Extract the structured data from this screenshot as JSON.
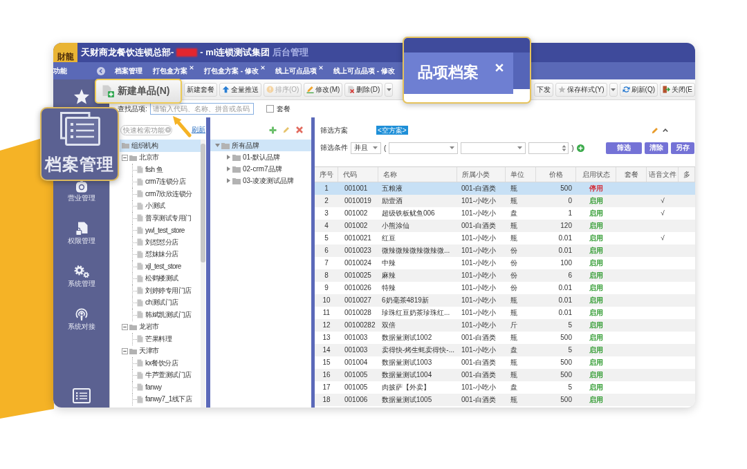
{
  "window": {
    "logo": "財龍",
    "title": "天财商龙餐饮连锁总部-",
    "company": "- ml连锁测试集团",
    "subtitle": "后台管理"
  },
  "tab_bar": {
    "menu_label": "功能",
    "tabs": [
      {
        "label": "档案管理",
        "closable": false,
        "selected": false
      },
      {
        "label": "打包盒方案",
        "closable": true,
        "selected": false
      },
      {
        "label": "打包盒方案 - 修改",
        "closable": true,
        "selected": false
      },
      {
        "label": "线上可点品项",
        "closable": true,
        "selected": false
      },
      {
        "label": "线上可点品项 - 修改",
        "closable": false,
        "selected": false
      }
    ]
  },
  "sidebar": {
    "items": [
      {
        "kind": "star"
      },
      {
        "kind": "bag",
        "label": "营业管理"
      },
      {
        "kind": "document-lock",
        "label": "权限管理"
      },
      {
        "kind": "gears",
        "label": "系统管理"
      },
      {
        "kind": "broadcast",
        "label": "系统对接"
      },
      {
        "kind": "list"
      }
    ]
  },
  "toolbar": {
    "left_buttons": [
      {
        "label": "新建套餐",
        "kind": "plain",
        "disabled": false,
        "dropdown": false
      },
      {
        "label": "全量推送",
        "kind": "push",
        "disabled": false,
        "dropdown": false
      },
      {
        "label": "排序(O)",
        "kind": "sort",
        "disabled": true,
        "dropdown": false
      },
      {
        "label": "修改(M)",
        "kind": "edit",
        "disabled": false,
        "dropdown": false
      },
      {
        "label": "删除(D)",
        "kind": "delete",
        "disabled": false,
        "dropdown": true
      }
    ],
    "right_buttons": [
      {
        "label": "下发",
        "kind": "plain",
        "disabled": false,
        "dropdown": false
      },
      {
        "label": "保存样式(Y)",
        "kind": "save",
        "disabled": false,
        "dropdown": true
      },
      {
        "label": "刷新(Q)",
        "kind": "refresh",
        "disabled": false,
        "dropdown": false
      },
      {
        "label": "关闭(E",
        "kind": "exit",
        "disabled": false,
        "dropdown": false
      }
    ]
  },
  "search": {
    "label": "查找品项:",
    "placeholder": "请输入代码、名称、拼音或条码",
    "checkbox": {
      "label": "套餐",
      "checked": false
    }
  },
  "org_panel": {
    "search_placeholder": "快速检索功能",
    "link": "刷新",
    "tree": [
      {
        "label": "组织机构",
        "selected": true,
        "children": [
          {
            "label": "北京市",
            "selected": false,
            "expanded": true,
            "children": [
              {
                "label": "fish 鱼",
                "selected": false
              },
              {
                "label": "crm7连锁分店",
                "selected": false
              },
              {
                "label": "crm7欣欣连锁分",
                "selected": false
              },
              {
                "label": "小测试",
                "selected": false
              },
              {
                "label": "普享测试专用门",
                "selected": false
              },
              {
                "label": "ywl_test_store",
                "selected": false
              },
              {
                "label": "刘怼怼分店",
                "selected": false
              },
              {
                "label": "怼妹妹分店",
                "selected": false
              },
              {
                "label": "xjl_test_store",
                "selected": false
              },
              {
                "label": "松鹤楼测试",
                "selected": false
              },
              {
                "label": "刘婷婷专用门店",
                "selected": false
              },
              {
                "label": "ch测试门店",
                "selected": false
              },
              {
                "label": "韩斌凯测试门店",
                "selected": false
              }
            ]
          },
          {
            "label": "龙岩市",
            "selected": false,
            "expanded": true,
            "children": [
              {
                "label": "芒果料理",
                "selected": false
              }
            ]
          },
          {
            "label": "天津市",
            "selected": false,
            "expanded": true,
            "children": [
              {
                "label": "kx餐饮分店",
                "selected": false
              },
              {
                "label": "牛芦萱测试门店",
                "selected": false
              },
              {
                "label": "fanwy",
                "selected": false
              },
              {
                "label": "fanwy7_1线下店",
                "selected": false
              }
            ]
          }
        ]
      }
    ]
  },
  "brand_panel": {
    "tree": [
      {
        "label": "所有品牌",
        "selected": true,
        "expanded": true,
        "children": [
          {
            "label": "01-默认品牌",
            "selected": false,
            "expanded": false
          },
          {
            "label": "02-crm7品牌",
            "selected": false,
            "expanded": false
          },
          {
            "label": "03-凌凌测试品牌",
            "selected": false,
            "expanded": false
          }
        ]
      }
    ]
  },
  "filter": {
    "scheme_label": "筛选方案",
    "scheme_value": "<空方案>",
    "condition_label": "筛选条件",
    "operator": "并且",
    "open_paren": "(",
    "close_paren": ")",
    "buttons": [
      "筛选",
      "清除",
      "另存"
    ]
  },
  "table": {
    "columns": [
      "序号",
      "代码",
      "名称",
      "所属小类",
      "单位",
      "价格",
      "启用状态",
      "套餐",
      "语音文件",
      "多"
    ],
    "rows": [
      {
        "no": "1",
        "code": "001001",
        "name": "五粮液",
        "category": "001-白酒类",
        "unit": "瓶",
        "price": "500",
        "status": "停用",
        "enabled": false,
        "selected": true
      },
      {
        "no": "2",
        "code": "0010019",
        "name": "励壹酒",
        "category": "101-小吃小",
        "unit": "瓶",
        "price": "0",
        "status": "启用",
        "enabled": true,
        "voice_file": "√",
        "selected": false
      },
      {
        "no": "3",
        "code": "001002",
        "name": "超级铁板鱿鱼006",
        "category": "101-小吃小",
        "unit": "盘",
        "price": "1",
        "status": "启用",
        "enabled": true,
        "voice_file": "√",
        "selected": false
      },
      {
        "no": "4",
        "code": "001002",
        "name": "小熊涂仙",
        "category": "001-白酒类",
        "unit": "瓶",
        "price": "120",
        "status": "启用",
        "enabled": true,
        "selected": false
      },
      {
        "no": "5",
        "code": "0010021",
        "name": "红豆",
        "category": "101-小吃小",
        "unit": "瓶",
        "price": "0.01",
        "status": "启用",
        "enabled": true,
        "voice_file": "√",
        "selected": false
      },
      {
        "no": "6",
        "code": "0010023",
        "name": "微辣微辣微辣微辣微...",
        "category": "101-小吃小",
        "unit": "份",
        "price": "0.01",
        "status": "启用",
        "enabled": true,
        "selected": false
      },
      {
        "no": "7",
        "code": "0010024",
        "name": "中辣",
        "category": "101-小吃小",
        "unit": "份",
        "price": "100",
        "status": "启用",
        "enabled": true,
        "selected": false
      },
      {
        "no": "8",
        "code": "0010025",
        "name": "麻辣",
        "category": "101-小吃小",
        "unit": "份",
        "price": "6",
        "status": "启用",
        "enabled": true,
        "selected": false
      },
      {
        "no": "9",
        "code": "0010026",
        "name": "特辣",
        "category": "101-小吃小",
        "unit": "份",
        "price": "0.01",
        "status": "启用",
        "enabled": true,
        "selected": false
      },
      {
        "no": "10",
        "code": "0010027",
        "name": "6奶毫茶4819新",
        "category": "101-小吃小",
        "unit": "瓶",
        "price": "0.01",
        "status": "启用",
        "enabled": true,
        "selected": false
      },
      {
        "no": "11",
        "code": "0010028",
        "name": "珍珠红豆奶茶珍珠红...",
        "category": "101-小吃小",
        "unit": "瓶",
        "price": "0.01",
        "status": "启用",
        "enabled": true,
        "selected": false
      },
      {
        "no": "12",
        "code": "00100282",
        "name": "双倍",
        "category": "101-小吃小",
        "unit": "斤",
        "price": "5",
        "status": "启用",
        "enabled": true,
        "selected": false
      },
      {
        "no": "13",
        "code": "001003",
        "name": "数据量测试1002",
        "category": "001-白酒类",
        "unit": "瓶",
        "price": "500",
        "status": "启用",
        "enabled": true,
        "selected": false
      },
      {
        "no": "14",
        "code": "001003",
        "name": "卖得快-烤生蚝卖得快-...",
        "category": "101-小吃小",
        "unit": "盘",
        "price": "5",
        "status": "启用",
        "enabled": true,
        "selected": false
      },
      {
        "no": "15",
        "code": "001004",
        "name": "数据量测试1003",
        "category": "001-白酒类",
        "unit": "瓶",
        "price": "500",
        "status": "启用",
        "enabled": true,
        "selected": false
      },
      {
        "no": "16",
        "code": "001005",
        "name": "数据量测试1004",
        "category": "001-白酒类",
        "unit": "瓶",
        "price": "500",
        "status": "启用",
        "enabled": true,
        "selected": false
      },
      {
        "no": "17",
        "code": "001005",
        "name": "肉披萨【外卖】",
        "category": "101-小吃小",
        "unit": "盘",
        "price": "5",
        "status": "启用",
        "enabled": true,
        "selected": false
      },
      {
        "no": "18",
        "code": "001006",
        "name": "数据量测试1005",
        "category": "001-白酒类",
        "unit": "瓶",
        "price": "500",
        "status": "启用",
        "enabled": true,
        "selected": false
      }
    ]
  },
  "callouts": [
    {
      "kind": "button",
      "label": "新建单品(N)"
    },
    {
      "kind": "tab",
      "label": "品项档案"
    },
    {
      "kind": "menu",
      "label": "档案管理"
    }
  ]
}
